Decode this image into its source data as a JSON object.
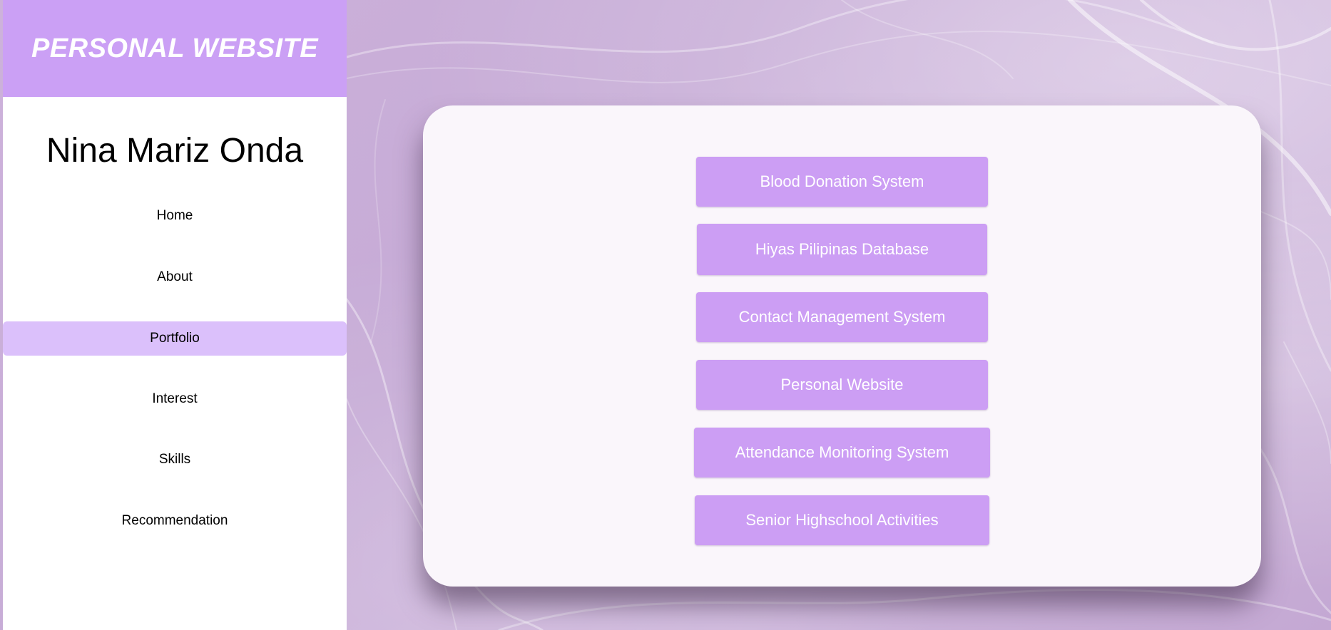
{
  "brand": {
    "title": "PERSONAL WEBSITE",
    "bar_color": "#cba0f5"
  },
  "owner": {
    "name": "Nina Mariz Onda"
  },
  "nav": {
    "items": [
      {
        "label": "Home",
        "active": false
      },
      {
        "label": "About",
        "active": false
      },
      {
        "label": "Portfolio",
        "active": true
      },
      {
        "label": "Interest",
        "active": false
      },
      {
        "label": "Skills",
        "active": false
      },
      {
        "label": "Recommendation",
        "active": false
      }
    ],
    "active_color": "#dbc0fb"
  },
  "portfolio": {
    "projects": [
      {
        "label": "Blood Donation System"
      },
      {
        "label": "Hiyas Pilipinas Database"
      },
      {
        "label": "Contact Management System"
      },
      {
        "label": "Personal Website"
      },
      {
        "label": "Attendance Monitoring System"
      },
      {
        "label": "Senior Highschool Activities"
      }
    ],
    "button_color": "#cc9ef4"
  },
  "colors": {
    "background": "#cbb3da",
    "card": "#faf6fb"
  }
}
